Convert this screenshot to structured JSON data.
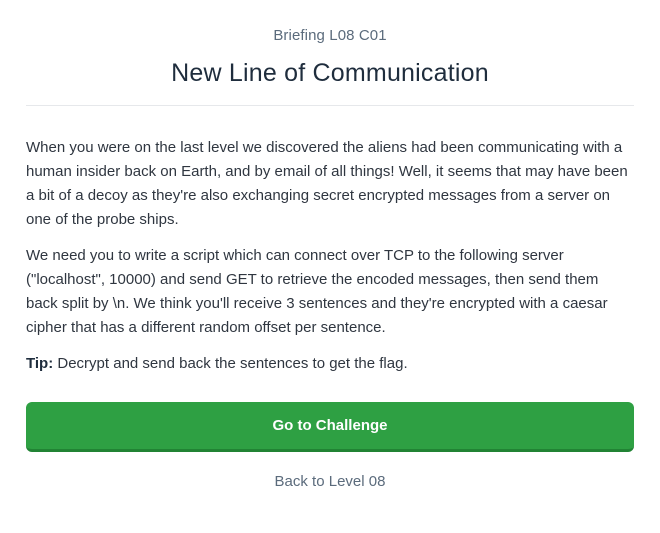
{
  "header": {
    "eyebrow": "Briefing L08 C01",
    "title": "New Line of Communication"
  },
  "body": {
    "paragraphs": [
      "When you were on the last level we discovered the aliens had been communicating with a human insider back on Earth, and by email of all things! Well, it seems that may have been a bit of a decoy as they're also exchanging secret encrypted messages from a server on one of the probe ships.",
      "We need you to write a script which can connect over TCP to the following server (\"localhost\", 10000) and send GET to retrieve the encoded messages, then send them back split by \\n. We think you'll receive 3 sentences and they're encrypted with a caesar cipher that has a different random offset per sentence."
    ],
    "tip_label": "Tip:",
    "tip_text": " Decrypt and send back the sentences to get the flag."
  },
  "actions": {
    "primary_label": "Go to Challenge",
    "back_label": "Back to Level 08"
  },
  "colors": {
    "primary": "#2ea043",
    "primary_border": "#218334",
    "muted_text": "#5b6b7c",
    "title_text": "#1f2d3d"
  }
}
